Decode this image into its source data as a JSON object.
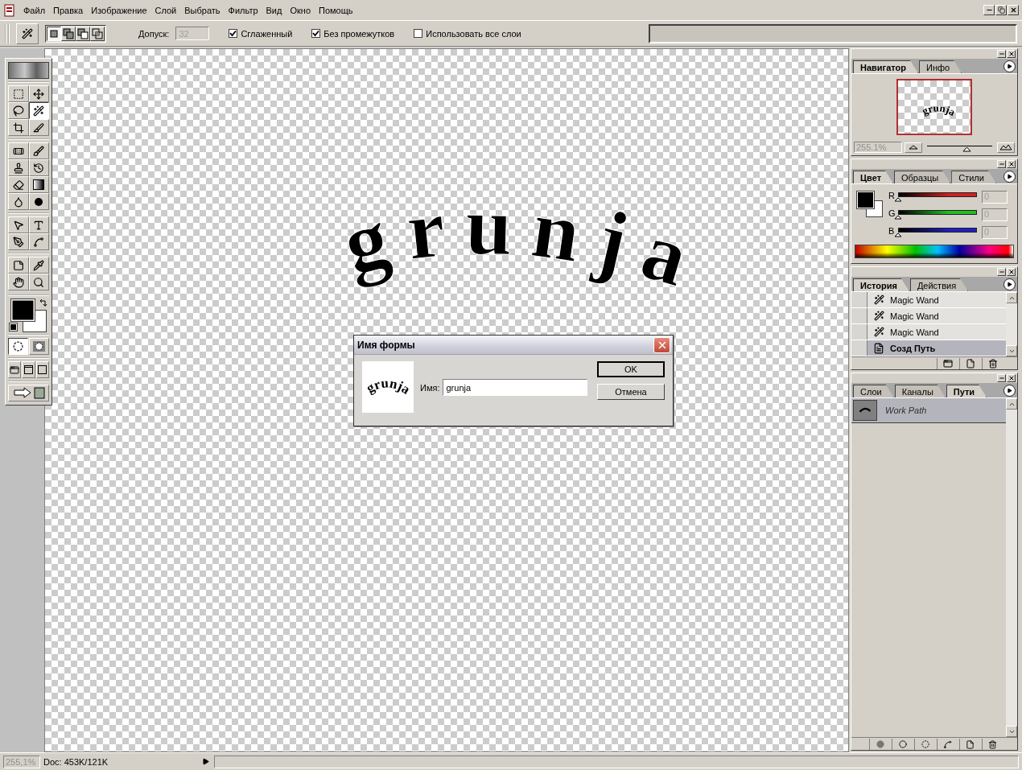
{
  "menu_bar": {
    "items": [
      "Файл",
      "Правка",
      "Изображение",
      "Слой",
      "Выбрать",
      "Фильтр",
      "Вид",
      "Окно",
      "Помощь"
    ]
  },
  "options_bar": {
    "selection_modes": [
      {
        "kind": "new",
        "selected": true
      },
      {
        "kind": "add",
        "selected": false
      },
      {
        "kind": "subtract",
        "selected": false
      },
      {
        "kind": "intersect",
        "selected": false
      }
    ],
    "tolerance": {
      "label": "Допуск:",
      "value": "32",
      "disabled": true
    },
    "checkboxes": [
      {
        "label": "Сглаженный",
        "checked": true
      },
      {
        "label": "Без промежутков",
        "checked": true
      },
      {
        "label": "Использовать все слои",
        "checked": false
      }
    ]
  },
  "toolbox": {
    "tools": [
      {
        "kind": "marquee",
        "selected": false
      },
      {
        "kind": "move",
        "selected": false
      },
      {
        "kind": "lasso",
        "selected": false
      },
      {
        "kind": "magic-wand",
        "selected": true
      },
      {
        "kind": "crop",
        "selected": false
      },
      {
        "kind": "slice",
        "selected": false
      },
      {
        "kind": "healing",
        "selected": false
      },
      {
        "kind": "brush",
        "selected": false
      },
      {
        "kind": "stamp",
        "selected": false
      },
      {
        "kind": "history-brush",
        "selected": false
      },
      {
        "kind": "eraser",
        "selected": false
      },
      {
        "kind": "gradient",
        "selected": false
      },
      {
        "kind": "blur",
        "selected": false
      },
      {
        "kind": "dodge",
        "selected": false
      },
      {
        "kind": "path-select",
        "selected": false
      },
      {
        "kind": "type",
        "selected": false
      },
      {
        "kind": "pen",
        "selected": false
      },
      {
        "kind": "shape",
        "selected": false
      },
      {
        "kind": "notes",
        "selected": false
      },
      {
        "kind": "eyedropper",
        "selected": false
      },
      {
        "kind": "hand",
        "selected": false
      },
      {
        "kind": "zoom",
        "selected": false
      }
    ],
    "mask_modes": [
      {
        "kind": "standard",
        "selected": true
      },
      {
        "kind": "quick-mask",
        "selected": false
      }
    ],
    "screen_modes": [
      {
        "kind": "standard"
      },
      {
        "kind": "full-menu"
      },
      {
        "kind": "full"
      }
    ]
  },
  "canvas": {
    "artwork_text": "grunja"
  },
  "dialog": {
    "title": "Имя формы",
    "preview_text": "grunja",
    "name_label": "Имя:",
    "name_value": "grunja",
    "buttons": [
      {
        "label": "OK",
        "default": true
      },
      {
        "label": "Отмена",
        "default": false
      }
    ]
  },
  "navigator_panel": {
    "tabs": [
      {
        "label": "Навигатор",
        "selected": true
      },
      {
        "label": "Инфо",
        "selected": false
      }
    ],
    "preview_text": "grunja",
    "zoom": "255.1%",
    "zoom_slider": {
      "level": 0.6
    }
  },
  "color_panel": {
    "tabs": [
      {
        "label": "Цвет",
        "selected": true
      },
      {
        "label": "Образцы",
        "selected": false
      },
      {
        "label": "Стили",
        "selected": false
      }
    ],
    "channels": [
      {
        "name": "R",
        "color": "#d02020",
        "level": 0,
        "value": "0"
      },
      {
        "name": "G",
        "color": "#20c020",
        "level": 0,
        "value": "0"
      },
      {
        "name": "B",
        "color": "#2020c0",
        "level": 0,
        "value": "0"
      }
    ]
  },
  "history_panel": {
    "tabs": [
      {
        "label": "История",
        "selected": true
      },
      {
        "label": "Действия",
        "selected": false
      }
    ],
    "items": [
      {
        "kind": "wand",
        "label": "Magic Wand",
        "selected": false
      },
      {
        "kind": "wand",
        "label": "Magic Wand",
        "selected": false
      },
      {
        "kind": "wand",
        "label": "Magic Wand",
        "selected": false
      },
      {
        "kind": "path",
        "label": "Созд Путь",
        "selected": true
      }
    ]
  },
  "paths_panel": {
    "tabs": [
      {
        "label": "Слои",
        "selected": false
      },
      {
        "label": "Каналы",
        "selected": false
      },
      {
        "label": "Пути",
        "selected": true
      }
    ],
    "items": [
      {
        "label": "Work Path",
        "selected": true
      }
    ]
  },
  "status_bar": {
    "zoom": "255,1%",
    "doc_info": "Doc: 453K/121K"
  }
}
